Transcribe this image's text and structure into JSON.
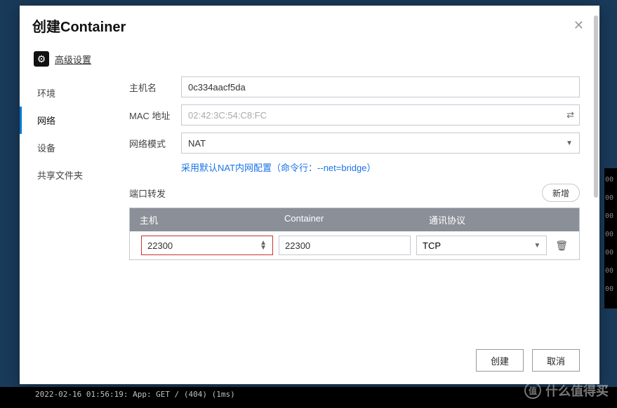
{
  "modal": {
    "title": "创建Container",
    "advanced_label": "高级设置",
    "tabs": [
      "环境",
      "网络",
      "设备",
      "共享文件夹"
    ],
    "form": {
      "hostname_label": "主机名",
      "hostname_value": "0c334aacf5da",
      "mac_label": "MAC 地址",
      "mac_placeholder": "02:42:3C:54:C8:FC",
      "netmode_label": "网络模式",
      "netmode_value": "NAT",
      "nat_hint": "采用默认NAT内网配置（命令行：--net=bridge）",
      "port_label": "端口转发",
      "add_label": "新增",
      "table": {
        "head_host": "主机",
        "head_container": "Container",
        "head_protocol": "通讯协议",
        "rows": [
          {
            "host": "22300",
            "container": "22300",
            "protocol": "TCP"
          }
        ]
      }
    },
    "footer": {
      "create": "创建",
      "cancel": "取消"
    }
  },
  "bg": {
    "terminal": "2022-02-16 01:56:19: App: GET / (404) (1ms)",
    "side_nums": "00\n00\n00\n00\n00\n00\n00",
    "watermark": "什么值得买",
    "watermark_inner": "值"
  }
}
